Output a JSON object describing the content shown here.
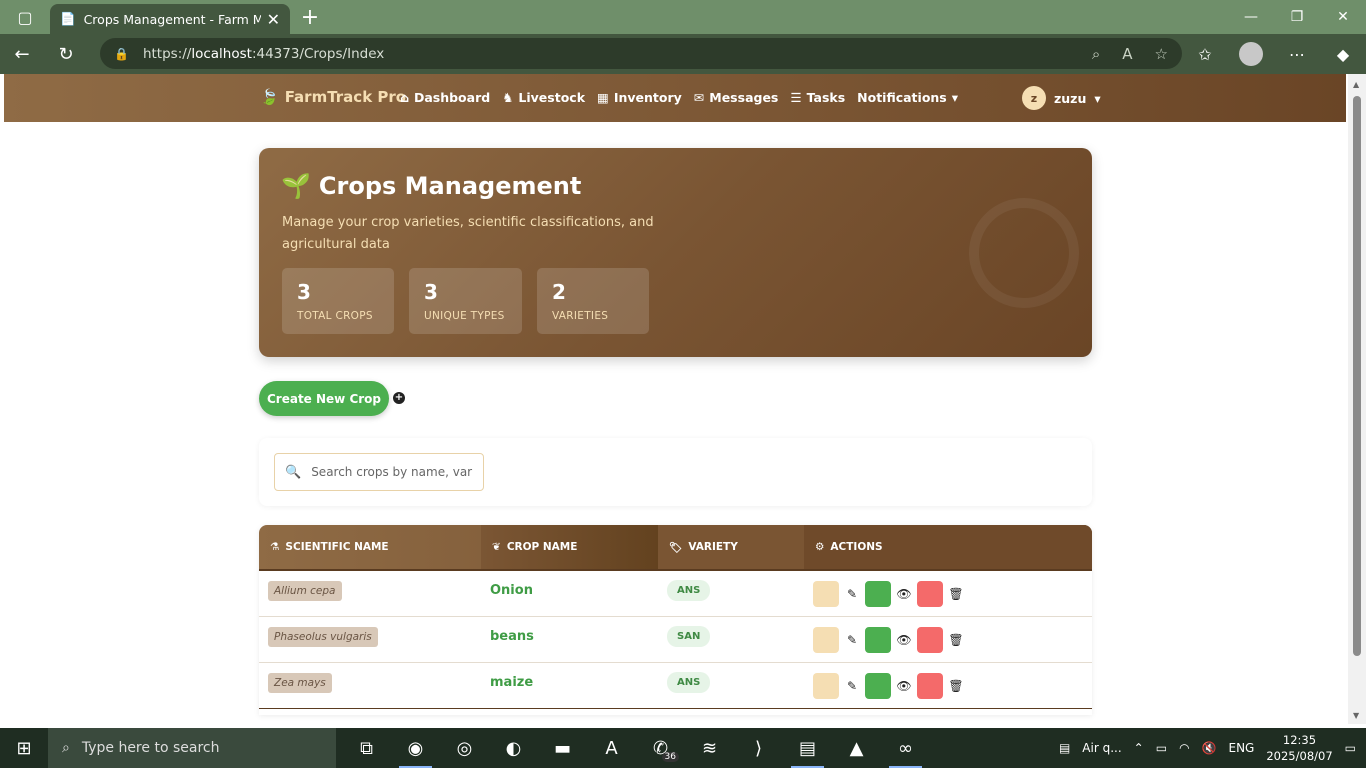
{
  "browser": {
    "tab_title": "Crops Management - Farm Mana",
    "url_prefix": "https://",
    "url_host": "localhost",
    "url_rest": ":44373/Crops/Index"
  },
  "app": {
    "brand": "FarmTrack Pro",
    "menu": [
      {
        "label": "Dashboard",
        "icon": "home-icon"
      },
      {
        "label": "Livestock",
        "icon": "horse-icon"
      },
      {
        "label": "Inventory",
        "icon": "boxes-icon"
      },
      {
        "label": "Messages",
        "icon": "envelope-icon"
      },
      {
        "label": "Tasks",
        "icon": "tasks-icon"
      },
      {
        "label": "Notifications",
        "icon": "caret-down-icon"
      }
    ],
    "user_initial": "z",
    "user_name": "zuzu"
  },
  "hero": {
    "title": "Crops Management",
    "subtitle": "Manage your crop varieties, scientific classifications, and agricultural data",
    "stats": [
      {
        "value": "3",
        "label": "TOTAL CROPS"
      },
      {
        "value": "3",
        "label": "UNIQUE TYPES"
      },
      {
        "value": "2",
        "label": "VARIETIES"
      }
    ]
  },
  "create_button": "Create New Crop",
  "search": {
    "placeholder": "Search crops by name, variety, or scientific name..."
  },
  "table": {
    "headers": [
      "SCIENTIFIC NAME",
      "CROP NAME",
      "VARIETY",
      "ACTIONS"
    ],
    "rows": [
      {
        "scientific": "Allium cepa",
        "crop": "Onion",
        "variety": "ANS"
      },
      {
        "scientific": "Phaseolus vulgaris",
        "crop": "beans",
        "variety": "SAN"
      },
      {
        "scientific": "Zea mays",
        "crop": "maize",
        "variety": "ANS"
      }
    ]
  },
  "taskbar": {
    "search_placeholder": "Type here to search",
    "whatsapp_badge": "36",
    "weather": "Air q...",
    "lang": "ENG",
    "time": "12:35",
    "date": "2025/08/07"
  },
  "colors": {
    "brown": "#7a5533",
    "wheat": "#f5deb3",
    "green": "#4caf50",
    "red": "#f46a6a"
  }
}
